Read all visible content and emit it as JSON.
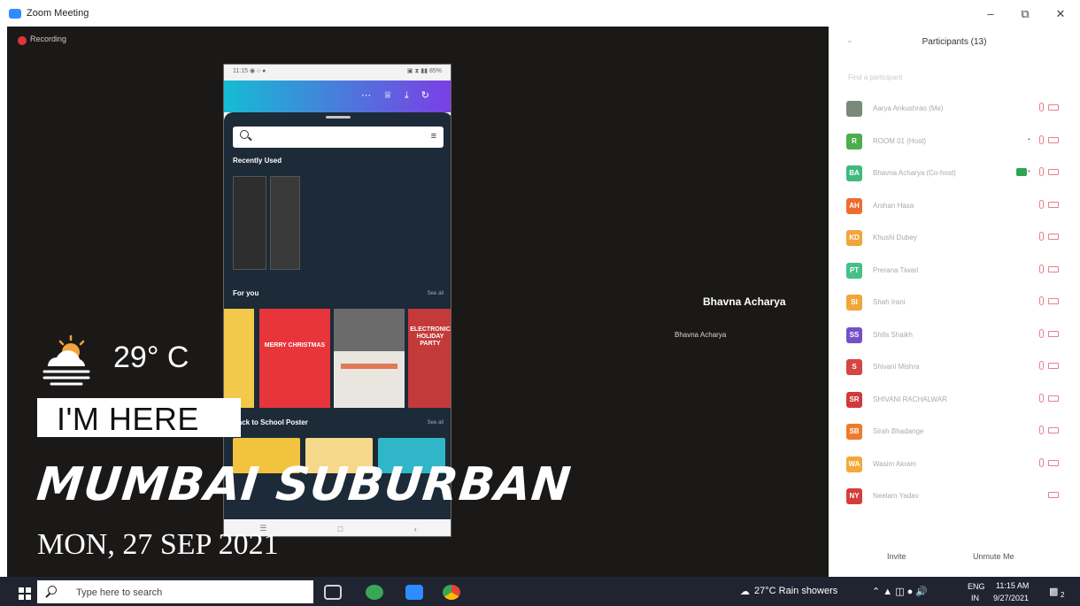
{
  "window": {
    "title": "Zoom Meeting",
    "minimize": "–",
    "restore": "⧉",
    "close": "✕"
  },
  "recording": {
    "label": "Recording"
  },
  "overlay": {
    "temperature": "29° C",
    "im_here": "I'M HERE",
    "place": "MUMBAI SUBURBAN",
    "date": "MON, 27 SEP 2021"
  },
  "speaker": {
    "name": "Bhavna Acharya",
    "label": "Bhavna Acharya"
  },
  "phone": {
    "status_left": "11:15 ◉ ○ ●",
    "status_right": "▣ ⧗ ▮▮ 85%",
    "recently_used": "Recently Used",
    "for_you": "For you",
    "see_all": "See all",
    "back_to_school": "Back to School Poster",
    "cards": [
      "MERRY CHRISTMAS",
      "ELECTRONIC HOLIDAY PARTY"
    ]
  },
  "participants": {
    "title": "Participants (13)",
    "find_placeholder": "Find a participant",
    "invite": "Invite",
    "unmute": "Unmute Me",
    "list": [
      {
        "initials": "",
        "name": "Aarya Ankushrao (Me)",
        "color": "#7a8a7a",
        "star": false,
        "badge": false
      },
      {
        "initials": "R",
        "name": "ROOM 01 (Host)",
        "color": "#4cae4c",
        "star": true,
        "badge": false
      },
      {
        "initials": "BA",
        "name": "Bhavna Acharya (Co-host)",
        "color": "#3dbb7b",
        "star": true,
        "badge": true
      },
      {
        "initials": "AH",
        "name": "Arshan Hasa",
        "color": "#ef6c2f",
        "star": false,
        "badge": false
      },
      {
        "initials": "KD",
        "name": "Khushi Dubey",
        "color": "#f0a63a",
        "star": false,
        "badge": false
      },
      {
        "initials": "PT",
        "name": "Prerana Tiwari",
        "color": "#45c086",
        "star": false,
        "badge": false
      },
      {
        "initials": "SI",
        "name": "Shah Irani",
        "color": "#f0a63a",
        "star": false,
        "badge": false
      },
      {
        "initials": "SS",
        "name": "Shifa Shaikh",
        "color": "#7750c9",
        "star": false,
        "badge": false
      },
      {
        "initials": "S",
        "name": "Shivani Mishra",
        "color": "#d54545",
        "star": false,
        "badge": false
      },
      {
        "initials": "SR",
        "name": "SHIVANI RACHALWAR",
        "color": "#d03a3a",
        "star": false,
        "badge": false
      },
      {
        "initials": "SB",
        "name": "Sirah Bhadange",
        "color": "#ef7a2a",
        "star": false,
        "badge": false
      },
      {
        "initials": "WA",
        "name": "Wasim Akram",
        "color": "#f2a93a",
        "star": false,
        "badge": false
      },
      {
        "initials": "NY",
        "name": "Neelam Yadav",
        "color": "#d43d3d",
        "star": false,
        "badge": false
      }
    ]
  },
  "taskbar": {
    "search_placeholder": "Type here to search",
    "weather": "27°C  Rain showers",
    "lang_top": "ENG",
    "lang_bottom": "IN",
    "time": "11:15 AM",
    "date": "9/27/2021",
    "notif_count": "2"
  },
  "colors": {
    "stage_bg": "#1b1918",
    "zoom_blue": "#2d8cff",
    "taskbar_bg": "#1f2430"
  }
}
